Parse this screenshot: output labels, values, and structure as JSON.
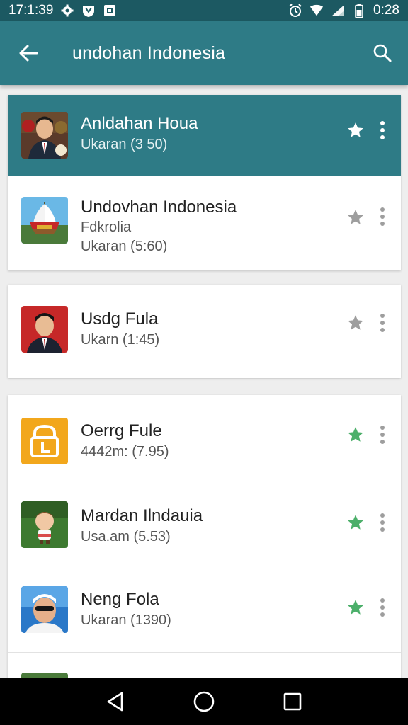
{
  "status_bar": {
    "left_time": "17:1:39",
    "right_time": "0:28"
  },
  "app_bar": {
    "title": "undohan Indonesia",
    "back_icon": "arrow-back-icon",
    "search_icon": "search-icon"
  },
  "items": [
    {
      "title": "Anldahan Houa",
      "line2": "Ukaran  (3 50)",
      "line3": "",
      "highlighted": true,
      "starred": true,
      "star_color": "#ffffff"
    },
    {
      "title": "Undovhan Indonesia",
      "line2": "Fdkrolia",
      "line3": "Ukaran  (5:60)",
      "highlighted": false,
      "starred": false,
      "star_color": "#9e9e9e"
    },
    {
      "title": "Usdg Fula",
      "line2": "Ukarn  (1:45)",
      "line3": "",
      "highlighted": false,
      "starred": false,
      "star_color": "#9e9e9e"
    },
    {
      "title": "Oerrg Fule",
      "line2": "4442m:  (7.95)",
      "line3": "",
      "highlighted": false,
      "starred": true,
      "star_color": "#4caf6a"
    },
    {
      "title": "Mardan Ilndauia",
      "line2": "Usa.am  (5.53)",
      "line3": "",
      "highlighted": false,
      "starred": true,
      "star_color": "#4caf6a"
    },
    {
      "title": "Neng Fola",
      "line2": "Ukaran  (1390)",
      "line3": "",
      "highlighted": false,
      "starred": true,
      "star_color": "#4caf6a"
    },
    {
      "title": "",
      "line2": "",
      "line3": "",
      "highlighted": false,
      "starred": false,
      "star_color": "#9e9e9e"
    }
  ],
  "nav_bar": {
    "back_icon": "nav-back-icon",
    "home_icon": "nav-home-icon",
    "recents_icon": "nav-recents-icon"
  },
  "colors": {
    "app_bar": "#2e7b86",
    "status_bar": "#1c5962",
    "star_active": "#4caf6a",
    "star_inactive": "#9e9e9e"
  }
}
